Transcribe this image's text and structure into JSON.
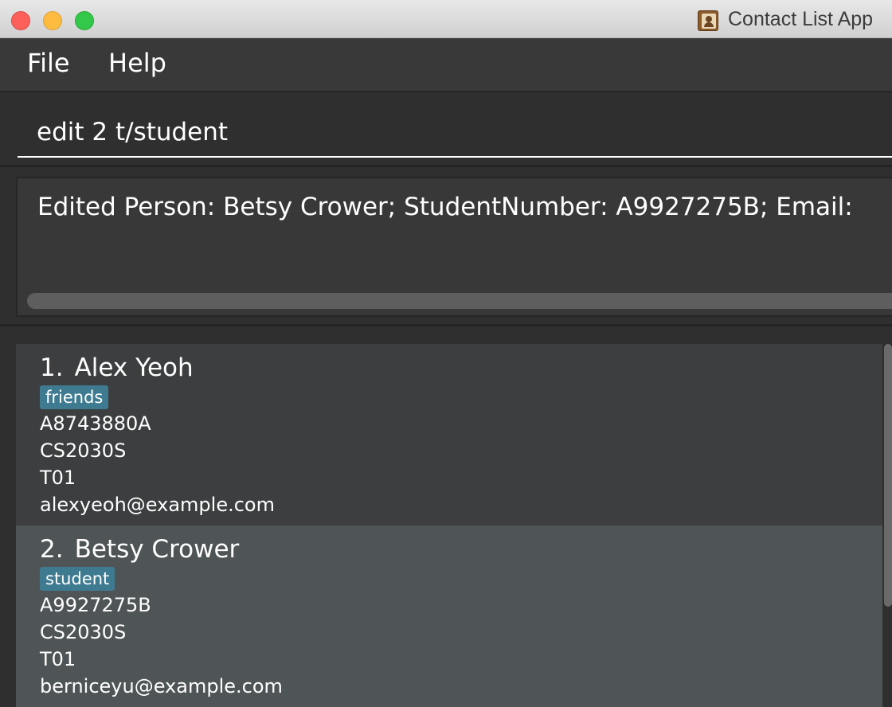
{
  "window": {
    "title": "Contact List App",
    "app_icon": "contacts-book-icon"
  },
  "menu": {
    "file": "File",
    "help": "Help"
  },
  "command": {
    "value": "edit 2 t/student"
  },
  "result": {
    "text": "Edited Person: Betsy Crower; StudentNumber: A9927275B; Email:"
  },
  "persons": [
    {
      "index": "1.",
      "name": "Alex Yeoh",
      "tag": "friends",
      "student_number": "A8743880A",
      "module": "CS2030S",
      "tutorial": "T01",
      "email": "alexyeoh@example.com"
    },
    {
      "index": "2.",
      "name": "Betsy Crower",
      "tag": "student",
      "student_number": "A9927275B",
      "module": "CS2030S",
      "tutorial": "T01",
      "email": "berniceyu@example.com"
    }
  ],
  "colors": {
    "tag_background": "#3e7b91",
    "selected_card": "#4f5556",
    "card": "#3c3e3f",
    "background": "#2f2f2f"
  }
}
